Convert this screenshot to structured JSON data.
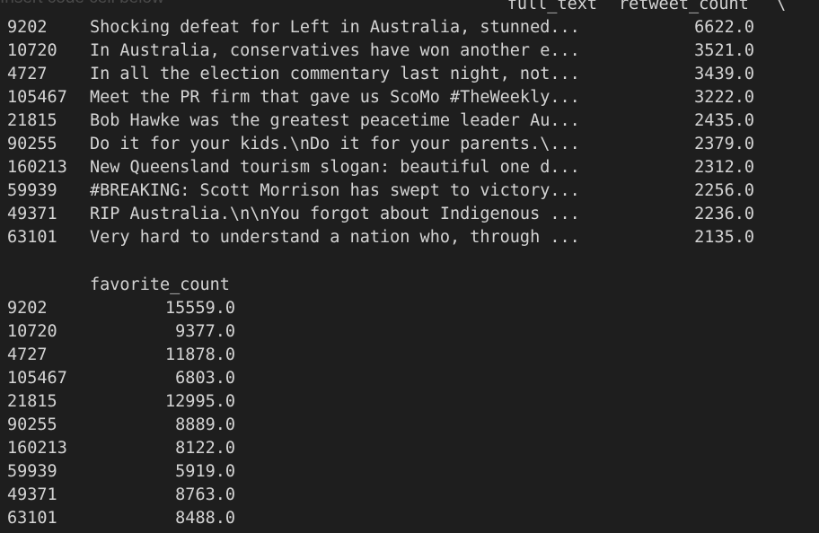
{
  "notebook": {
    "placeholder_hint": "Insert code cell below"
  },
  "table1": {
    "columns": [
      "full_text",
      "retweet_count"
    ],
    "continuation": "\\",
    "rows": [
      {
        "index": "9202",
        "full_text": "Shocking defeat for Left in Australia, stunned...",
        "retweet_count": "6622.0"
      },
      {
        "index": "10720",
        "full_text": "In Australia, conservatives have won another e...",
        "retweet_count": "3521.0"
      },
      {
        "index": "4727",
        "full_text": "In all the election commentary last night, not...",
        "retweet_count": "3439.0"
      },
      {
        "index": "105467",
        "full_text": "Meet the PR firm that gave us ScoMo #TheWeekly...",
        "retweet_count": "3222.0"
      },
      {
        "index": "21815",
        "full_text": "Bob Hawke was the greatest peacetime leader Au...",
        "retweet_count": "2435.0"
      },
      {
        "index": "90255",
        "full_text": "Do it for your kids.\\nDo it for your parents.\\...",
        "retweet_count": "2379.0"
      },
      {
        "index": "160213",
        "full_text": "New Queensland tourism slogan: beautiful one d...",
        "retweet_count": "2312.0"
      },
      {
        "index": "59939",
        "full_text": "#BREAKING: Scott Morrison has swept to victory...",
        "retweet_count": "2256.0"
      },
      {
        "index": "49371",
        "full_text": "RIP Australia.\\n\\nYou forgot about Indigenous ...",
        "retweet_count": "2236.0"
      },
      {
        "index": "63101",
        "full_text": "Very hard to understand a nation who, through ...",
        "retweet_count": "2135.0"
      }
    ]
  },
  "table2": {
    "columns": [
      "favorite_count"
    ],
    "rows": [
      {
        "index": "9202",
        "favorite_count": "15559.0"
      },
      {
        "index": "10720",
        "favorite_count": "9377.0"
      },
      {
        "index": "4727",
        "favorite_count": "11878.0"
      },
      {
        "index": "105467",
        "favorite_count": "6803.0"
      },
      {
        "index": "21815",
        "favorite_count": "12995.0"
      },
      {
        "index": "90255",
        "favorite_count": "8889.0"
      },
      {
        "index": "160213",
        "favorite_count": "8122.0"
      },
      {
        "index": "59939",
        "favorite_count": "5919.0"
      },
      {
        "index": "49371",
        "favorite_count": "8763.0"
      },
      {
        "index": "63101",
        "favorite_count": "8488.0"
      }
    ]
  }
}
